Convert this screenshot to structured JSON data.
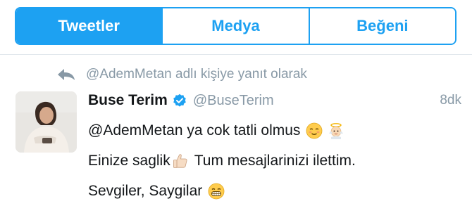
{
  "tabs": [
    {
      "label": "Tweetler",
      "active": true
    },
    {
      "label": "Medya",
      "active": false
    },
    {
      "label": "Beğeni",
      "active": false
    }
  ],
  "reply_context": {
    "icon": "reply-arrow-icon",
    "text": "@AdemMetan adlı kişiye yanıt olarak"
  },
  "tweet": {
    "name": "Buse Terim",
    "verified_icon": "verified-badge-icon",
    "handle": "@BuseTerim",
    "time": "8dk",
    "line1": "@AdemMetan ya cok tatli olmus",
    "line1_emojis": [
      "relieved-face-emoji",
      "baby-angel-emoji"
    ],
    "line2_a": "Einize saglik",
    "line2_emoji": "thumbs-up-emoji",
    "line2_b": "Tum mesajlarinizi ilettim.",
    "line3": "Sevgiler, Saygilar",
    "line3_emoji": "grinning-face-emoji"
  },
  "colors": {
    "accent": "#1da1f2",
    "secondary_text": "#8899a6",
    "divider": "#e1e8ed"
  }
}
